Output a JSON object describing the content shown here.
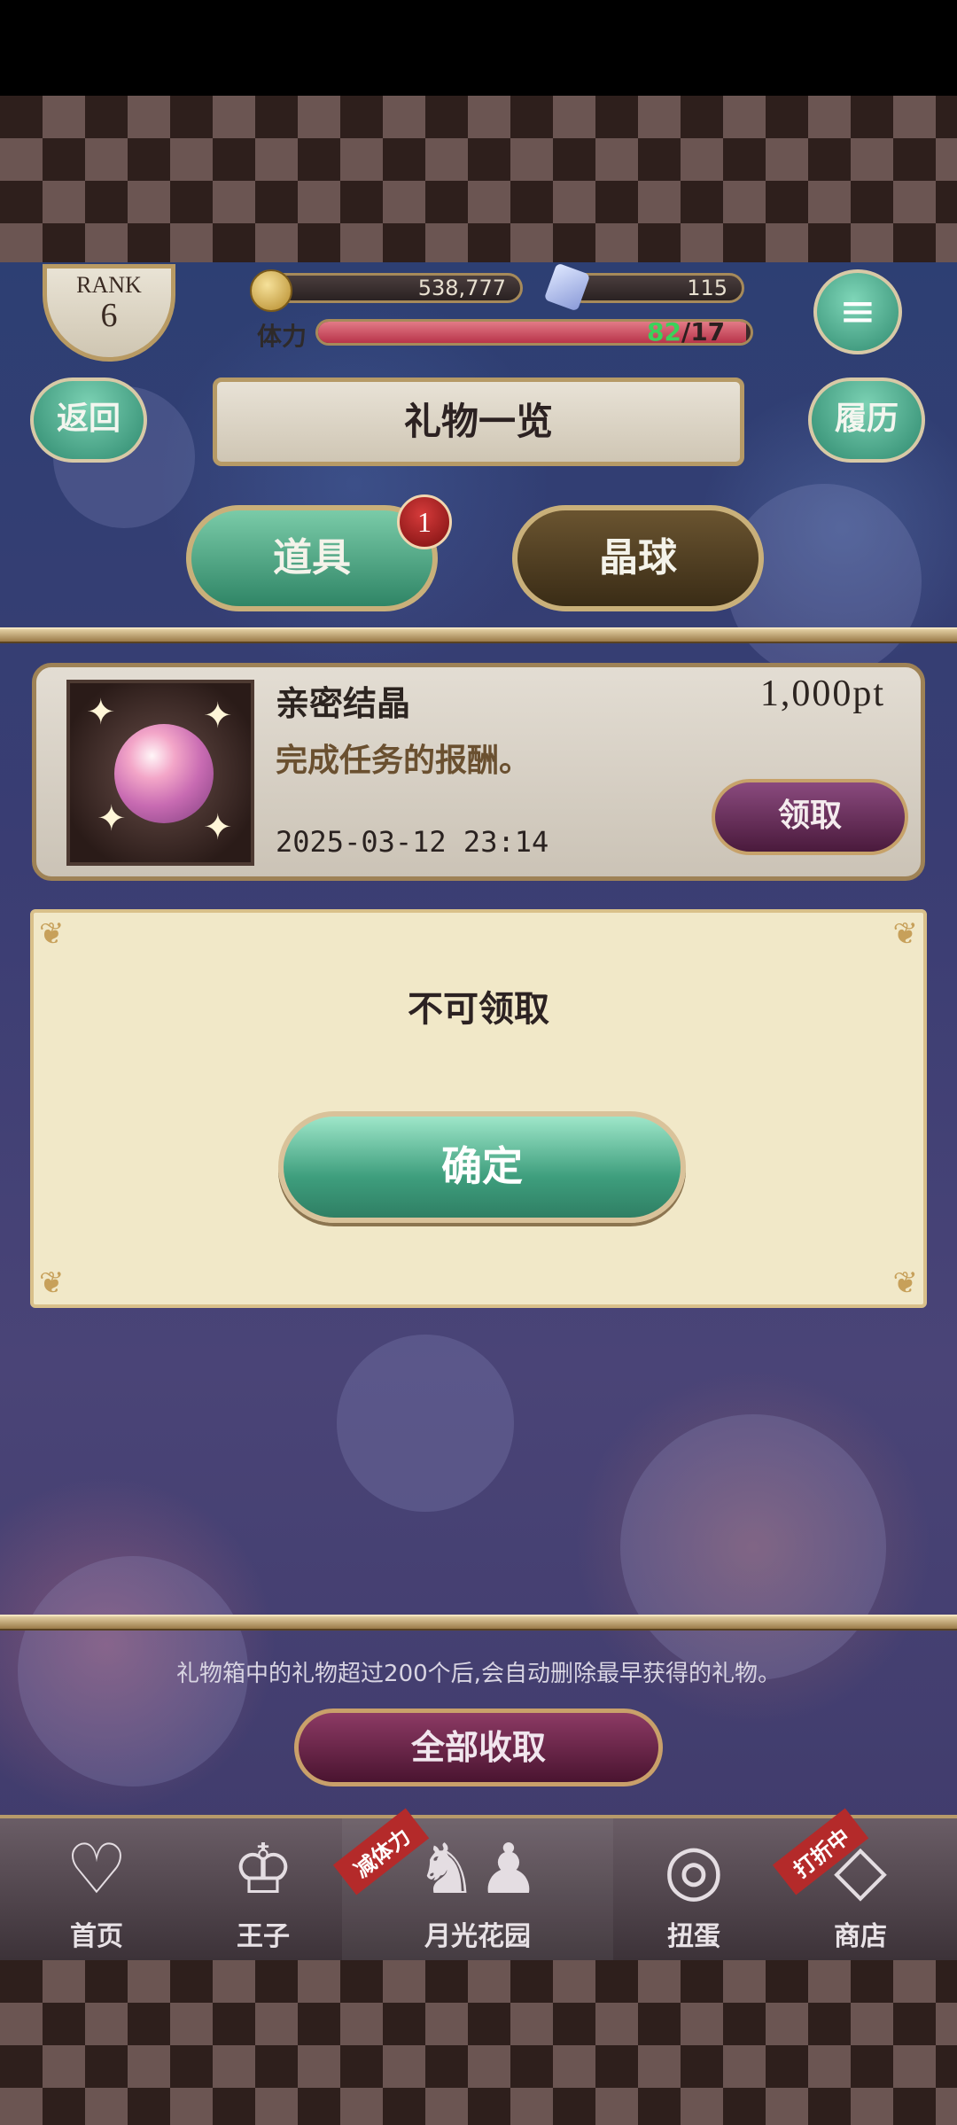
{
  "header": {
    "rank_label": "RANK",
    "rank_value": "6",
    "coins": "538,777",
    "gems": "115",
    "stamina_label": "体力",
    "stamina_current": "82",
    "stamina_max": "/17",
    "stamina_fill_fraction": 0.99
  },
  "nav": {
    "back_label": "返回",
    "title": "礼物一览",
    "history_label": "履历",
    "menu_icon": "≡"
  },
  "tabs": {
    "items_label": "道具",
    "items_badge": "1",
    "orbs_label": "晶球"
  },
  "gift": {
    "name": "亲密结晶",
    "points": "1,000pt",
    "description": "完成任务的报酬。",
    "date": "2025-03-12 23:14",
    "claim_label": "领取"
  },
  "dialog": {
    "message": "不可领取",
    "confirm_label": "确定"
  },
  "footer": {
    "notice": "礼物箱中的礼物超过200个后,会自动删除最早获得的礼物。",
    "claim_all_label": "全部收取"
  },
  "bottom_nav": {
    "home": "首页",
    "prince": "王子",
    "garden": "月光花园",
    "garden_ribbon": "减体力",
    "gacha": "扭蛋",
    "shop": "商店",
    "shop_ribbon": "打折中",
    "icons": {
      "home": "heart-icon",
      "prince": "crown-icon",
      "garden": "garden-silhouette-icon",
      "gacha": "ring-icon",
      "shop": "crystal-icon"
    }
  }
}
